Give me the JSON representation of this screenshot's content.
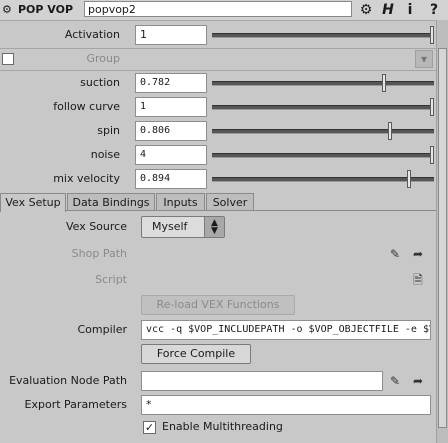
{
  "header": {
    "op_label": "POP VOP",
    "node_name": "popvop2",
    "help_glyph": "?",
    "info_glyph": "i",
    "h_glyph": "H"
  },
  "params": {
    "activation": {
      "label": "Activation",
      "value": "1",
      "fraction": 1.0
    },
    "group": {
      "label": "Group",
      "value": ""
    },
    "suction": {
      "label": "suction",
      "value": "0.782",
      "fraction": 0.782
    },
    "follow_curve": {
      "label": "follow curve",
      "value": "1",
      "fraction": 1.0
    },
    "spin": {
      "label": "spin",
      "value": "0.806",
      "fraction": 0.806
    },
    "noise": {
      "label": "noise",
      "value": "4",
      "fraction": 1.0
    },
    "mix_velocity": {
      "label": "mix velocity",
      "value": "0.894",
      "fraction": 0.894
    }
  },
  "tabs": [
    {
      "label": "Vex Setup",
      "active": true
    },
    {
      "label": "Data Bindings",
      "active": false
    },
    {
      "label": "Inputs",
      "active": false
    },
    {
      "label": "Solver",
      "active": false
    }
  ],
  "vex": {
    "source_label": "Vex Source",
    "source_value": "Myself",
    "shop_path_label": "Shop Path",
    "script_label": "Script",
    "reload_button": "Re-load VEX Functions",
    "compiler_label": "Compiler",
    "compiler_value": "vcc -q $VOP_INCLUDEPATH -o $VOP_OBJECTFILE -e $VOP_ERRORFILE $VOP_SOURCEFILE",
    "force_compile_button": "Force Compile",
    "eval_node_path_label": "Evaluation Node Path",
    "eval_node_path_value": "",
    "export_params_label": "Export Parameters",
    "export_params_value": "*",
    "multithreading_label": "Enable Multithreading",
    "multithreading_checked": true
  }
}
